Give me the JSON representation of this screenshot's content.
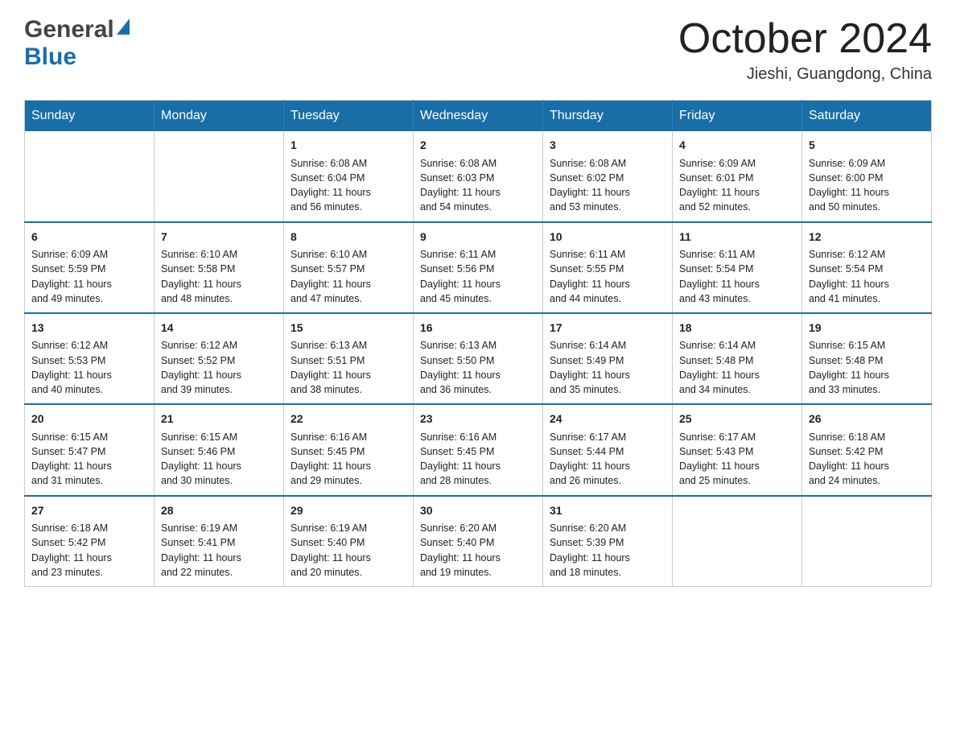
{
  "header": {
    "title": "October 2024",
    "location": "Jieshi, Guangdong, China",
    "logo": {
      "general": "General",
      "blue": "Blue"
    }
  },
  "weekdays": [
    "Sunday",
    "Monday",
    "Tuesday",
    "Wednesday",
    "Thursday",
    "Friday",
    "Saturday"
  ],
  "weeks": [
    [
      {
        "day": "",
        "info": ""
      },
      {
        "day": "",
        "info": ""
      },
      {
        "day": "1",
        "info": "Sunrise: 6:08 AM\nSunset: 6:04 PM\nDaylight: 11 hours\nand 56 minutes."
      },
      {
        "day": "2",
        "info": "Sunrise: 6:08 AM\nSunset: 6:03 PM\nDaylight: 11 hours\nand 54 minutes."
      },
      {
        "day": "3",
        "info": "Sunrise: 6:08 AM\nSunset: 6:02 PM\nDaylight: 11 hours\nand 53 minutes."
      },
      {
        "day": "4",
        "info": "Sunrise: 6:09 AM\nSunset: 6:01 PM\nDaylight: 11 hours\nand 52 minutes."
      },
      {
        "day": "5",
        "info": "Sunrise: 6:09 AM\nSunset: 6:00 PM\nDaylight: 11 hours\nand 50 minutes."
      }
    ],
    [
      {
        "day": "6",
        "info": "Sunrise: 6:09 AM\nSunset: 5:59 PM\nDaylight: 11 hours\nand 49 minutes."
      },
      {
        "day": "7",
        "info": "Sunrise: 6:10 AM\nSunset: 5:58 PM\nDaylight: 11 hours\nand 48 minutes."
      },
      {
        "day": "8",
        "info": "Sunrise: 6:10 AM\nSunset: 5:57 PM\nDaylight: 11 hours\nand 47 minutes."
      },
      {
        "day": "9",
        "info": "Sunrise: 6:11 AM\nSunset: 5:56 PM\nDaylight: 11 hours\nand 45 minutes."
      },
      {
        "day": "10",
        "info": "Sunrise: 6:11 AM\nSunset: 5:55 PM\nDaylight: 11 hours\nand 44 minutes."
      },
      {
        "day": "11",
        "info": "Sunrise: 6:11 AM\nSunset: 5:54 PM\nDaylight: 11 hours\nand 43 minutes."
      },
      {
        "day": "12",
        "info": "Sunrise: 6:12 AM\nSunset: 5:54 PM\nDaylight: 11 hours\nand 41 minutes."
      }
    ],
    [
      {
        "day": "13",
        "info": "Sunrise: 6:12 AM\nSunset: 5:53 PM\nDaylight: 11 hours\nand 40 minutes."
      },
      {
        "day": "14",
        "info": "Sunrise: 6:12 AM\nSunset: 5:52 PM\nDaylight: 11 hours\nand 39 minutes."
      },
      {
        "day": "15",
        "info": "Sunrise: 6:13 AM\nSunset: 5:51 PM\nDaylight: 11 hours\nand 38 minutes."
      },
      {
        "day": "16",
        "info": "Sunrise: 6:13 AM\nSunset: 5:50 PM\nDaylight: 11 hours\nand 36 minutes."
      },
      {
        "day": "17",
        "info": "Sunrise: 6:14 AM\nSunset: 5:49 PM\nDaylight: 11 hours\nand 35 minutes."
      },
      {
        "day": "18",
        "info": "Sunrise: 6:14 AM\nSunset: 5:48 PM\nDaylight: 11 hours\nand 34 minutes."
      },
      {
        "day": "19",
        "info": "Sunrise: 6:15 AM\nSunset: 5:48 PM\nDaylight: 11 hours\nand 33 minutes."
      }
    ],
    [
      {
        "day": "20",
        "info": "Sunrise: 6:15 AM\nSunset: 5:47 PM\nDaylight: 11 hours\nand 31 minutes."
      },
      {
        "day": "21",
        "info": "Sunrise: 6:15 AM\nSunset: 5:46 PM\nDaylight: 11 hours\nand 30 minutes."
      },
      {
        "day": "22",
        "info": "Sunrise: 6:16 AM\nSunset: 5:45 PM\nDaylight: 11 hours\nand 29 minutes."
      },
      {
        "day": "23",
        "info": "Sunrise: 6:16 AM\nSunset: 5:45 PM\nDaylight: 11 hours\nand 28 minutes."
      },
      {
        "day": "24",
        "info": "Sunrise: 6:17 AM\nSunset: 5:44 PM\nDaylight: 11 hours\nand 26 minutes."
      },
      {
        "day": "25",
        "info": "Sunrise: 6:17 AM\nSunset: 5:43 PM\nDaylight: 11 hours\nand 25 minutes."
      },
      {
        "day": "26",
        "info": "Sunrise: 6:18 AM\nSunset: 5:42 PM\nDaylight: 11 hours\nand 24 minutes."
      }
    ],
    [
      {
        "day": "27",
        "info": "Sunrise: 6:18 AM\nSunset: 5:42 PM\nDaylight: 11 hours\nand 23 minutes."
      },
      {
        "day": "28",
        "info": "Sunrise: 6:19 AM\nSunset: 5:41 PM\nDaylight: 11 hours\nand 22 minutes."
      },
      {
        "day": "29",
        "info": "Sunrise: 6:19 AM\nSunset: 5:40 PM\nDaylight: 11 hours\nand 20 minutes."
      },
      {
        "day": "30",
        "info": "Sunrise: 6:20 AM\nSunset: 5:40 PM\nDaylight: 11 hours\nand 19 minutes."
      },
      {
        "day": "31",
        "info": "Sunrise: 6:20 AM\nSunset: 5:39 PM\nDaylight: 11 hours\nand 18 minutes."
      },
      {
        "day": "",
        "info": ""
      },
      {
        "day": "",
        "info": ""
      }
    ]
  ]
}
